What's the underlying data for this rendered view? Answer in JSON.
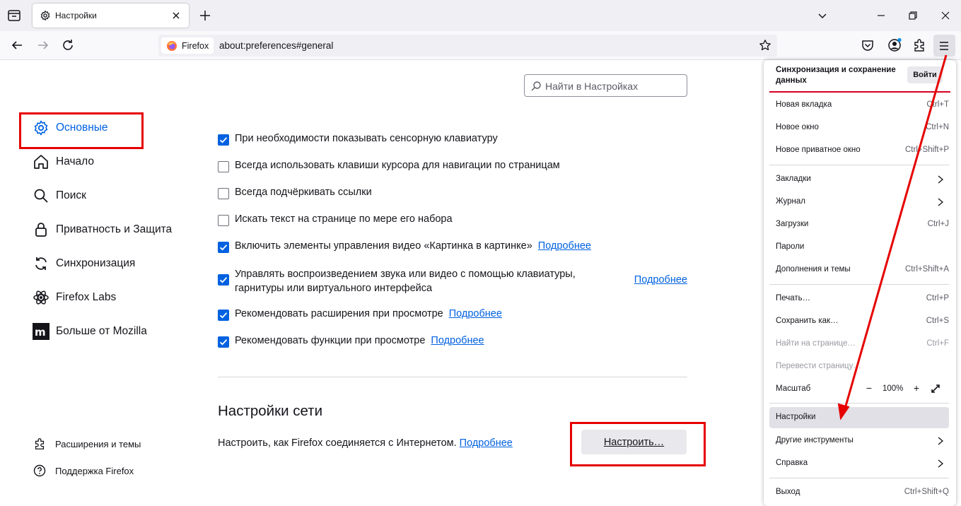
{
  "browser": {
    "tab_title": "Настройки",
    "identity_label": "Firefox",
    "url": "about:preferences#general"
  },
  "search": {
    "placeholder": "Найти в Настройках"
  },
  "sidebar": {
    "categories": [
      {
        "label": "Основные",
        "icon": "gear-icon",
        "selected": true
      },
      {
        "label": "Начало",
        "icon": "home-icon"
      },
      {
        "label": "Поиск",
        "icon": "search-icon"
      },
      {
        "label": "Приватность и Защита",
        "icon": "lock-icon"
      },
      {
        "label": "Синхронизация",
        "icon": "sync-icon"
      },
      {
        "label": "Firefox Labs",
        "icon": "labs-icon"
      },
      {
        "label": "Больше от Mozilla",
        "icon": "mozilla-icon"
      }
    ],
    "footer": [
      {
        "label": "Расширения и темы",
        "icon": "puzzle-icon"
      },
      {
        "label": "Поддержка Firefox",
        "icon": "help-icon"
      }
    ]
  },
  "options": [
    {
      "label": "При необходимости показывать сенсорную клавиатуру",
      "checked": true
    },
    {
      "label": "Всегда использовать клавиши курсора для навигации по страницам",
      "checked": false
    },
    {
      "label": "Всегда подчёркивать ссылки",
      "checked": false
    },
    {
      "label": "Искать текст на странице по мере его набора",
      "checked": false
    },
    {
      "label": "Включить элементы управления видео «Картинка в картинке»",
      "checked": true,
      "link": "Подробнее"
    },
    {
      "label": "Управлять воспроизведением звука или видео с помощью клавиатуры, гарнитуры или виртуального интерфейса",
      "checked": true,
      "link": "Подробнее"
    },
    {
      "label": "Рекомендовать расширения при просмотре",
      "checked": true,
      "link": "Подробнее"
    },
    {
      "label": "Рекомендовать функции при просмотре",
      "checked": true,
      "link": "Подробнее"
    }
  ],
  "network": {
    "heading": "Настройки сети",
    "description": "Настроить, как Firefox соединяется с Интернетом.",
    "link": "Подробнее",
    "button": "Настроить…"
  },
  "appmenu": {
    "sync_text": "Синхронизация и сохранение данных",
    "login": "Войти",
    "items": [
      {
        "label": "Новая вкладка",
        "shortcut": "Ctrl+T"
      },
      {
        "label": "Новое окно",
        "shortcut": "Ctrl+N"
      },
      {
        "label": "Новое приватное окно",
        "shortcut": "Ctrl+Shift+P"
      },
      {
        "label": "Закладки",
        "submenu": true
      },
      {
        "label": "Журнал",
        "submenu": true
      },
      {
        "label": "Загрузки",
        "shortcut": "Ctrl+J"
      },
      {
        "label": "Пароли"
      },
      {
        "label": "Дополнения и темы",
        "shortcut": "Ctrl+Shift+A"
      },
      {
        "label": "Печать…",
        "shortcut": "Ctrl+P"
      },
      {
        "label": "Сохранить как…",
        "shortcut": "Ctrl+S"
      },
      {
        "label": "Найти на странице…",
        "shortcut": "Ctrl+F",
        "disabled": true
      },
      {
        "label": "Перевести страницу…",
        "disabled": true
      },
      {
        "label": "Масштаб",
        "zoom": "100%"
      },
      {
        "label": "Настройки",
        "active": true
      },
      {
        "label": "Другие инструменты",
        "submenu": true
      },
      {
        "label": "Справка",
        "submenu": true
      },
      {
        "label": "Выход",
        "shortcut": "Ctrl+Shift+Q"
      }
    ]
  },
  "annotation_color": "#e60000",
  "accent_color": "#0061e0"
}
